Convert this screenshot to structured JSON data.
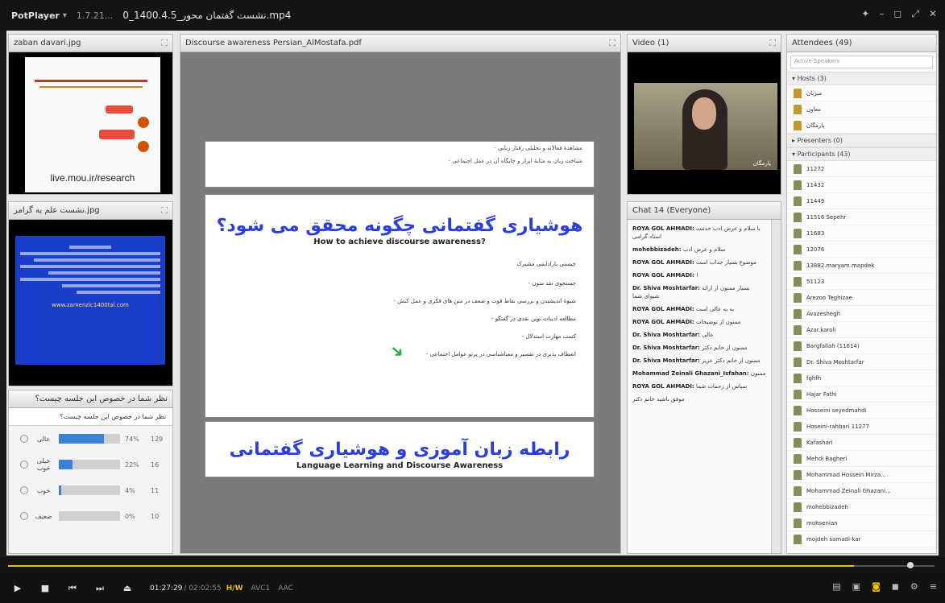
{
  "window": {
    "app_name": "PotPlayer",
    "version": "1.7.21...",
    "file_name": "0_1400.4.5_نشست گفتمان محور.mp4"
  },
  "left": {
    "image_pod_title": "zaban davari.jpg",
    "image_url_text": "live.mou.ir/research",
    "blue_pod_title": "نشست علم به گرامر.jpg",
    "blue_link_text": "www.zamenzic1400tal.com",
    "poll_title": "نظر شما در خصوص این جلسه چیست؟",
    "poll_question": "نظر شما در خصوص این جلسه چیست؟",
    "poll_options": [
      {
        "label": "عالی",
        "pct": "74%",
        "count": "129",
        "fraction": 0.74
      },
      {
        "label": "خیلی خوب",
        "pct": "22%",
        "count": "16",
        "fraction": 0.22
      },
      {
        "label": "خوب",
        "pct": "4%",
        "count": "11",
        "fraction": 0.04
      },
      {
        "label": "ضعیف",
        "pct": "0%",
        "count": "10",
        "fraction": 0.0
      }
    ]
  },
  "document": {
    "pod_title": "Discourse awareness Persian_AlMostafa.pdf",
    "slide1_line1": "- مشاهدهٔ فعالانه و تحلیلی رفتار زبانی",
    "slide1_line2": "- شناخت زبان به مثابهٔ ابزار و جایگاه آن در عمل اجتماعی",
    "slide2_title_fa": "هوشیاری گفتمانی چگونه محقق می شود؟",
    "slide2_title_en": "How to achieve discourse awareness?",
    "slide2_intro": "چیستی بارادایمی مشترک",
    "slide2_bullets": [
      "- جستجوی نقد متون",
      "- شیوهٔ اندیشیدن و بررسی نقاط قوت و ضعف در متن های فکری و عمل کنش",
      "- مطالعه ادبیات نوین نقدی در گفتگو",
      "- کسب مهارت استدلال",
      "- انعطاف پذیری در تفسیر و معناشناسی در پرتو عوامل اجتماعی"
    ],
    "slide3_title_fa": "رابطه زبان آموزی و هوشیاری گفتمانی",
    "slide3_title_en": "Language Learning and Discourse Awareness"
  },
  "video": {
    "pod_title": "Video (1)",
    "speaker_name": "پارمگان"
  },
  "chat": {
    "pod_title": "Chat 14 (Everyone)",
    "messages": [
      {
        "who": "ROYA GOL AHMADI:",
        "text": "با سلام و عرض ادب خدمت استاد گرامی"
      },
      {
        "who": "mohebbizadeh:",
        "text": "سلام و عرض ادب"
      },
      {
        "who": "ROYA GOL AHMADI:",
        "text": "موضوع بسیار جذاب است"
      },
      {
        "who": "ROYA GOL AHMADI:",
        "text": "!"
      },
      {
        "who": "Dr. Shiva Moshtarfar:",
        "text": "بسیار ممنون از ارائه شیوای شما"
      },
      {
        "who": "ROYA GOL AHMADI:",
        "text": "به به عالی است"
      },
      {
        "who": "ROYA GOL AHMADI:",
        "text": "ممنون از توضیحات"
      },
      {
        "who": "Dr. Shiva Moshtarfar:",
        "text": "عالی"
      },
      {
        "who": "Dr. Shiva Moshtarfar:",
        "text": "ممنون از خانم دکتر"
      },
      {
        "who": "Dr. Shiva Moshtarfar:",
        "text": "ممنون از خانم دکتر عزیز"
      },
      {
        "who": "Mohammad Zeinali Ghazani_Isfahan:",
        "text": "ممنون"
      },
      {
        "who": "ROYA GOL AHMADI:",
        "text": "سپاس از زحمات شما"
      },
      {
        "who": "",
        "text": "موفق باشید خانم دکتر"
      }
    ]
  },
  "attendees": {
    "pod_title": "Attendees (49)",
    "search_placeholder": "Active Speakers",
    "hosts_header": "Hosts (3)",
    "presenters_header": "Presenters (0)",
    "participants_header": "Participants (43)",
    "hosts": [
      "میزبان",
      "معاون",
      "پارمگان"
    ],
    "participants": [
      "11272",
      "11432",
      "11449",
      "11516 Sepehr",
      "11683",
      "12076",
      "13882.maryam.mapdek",
      "51123",
      "Arezoo Teghizae",
      "Avazeshegh",
      "Azar.karoli",
      "Bargfallah (11614)",
      "Dr. Shiva Moshtarfar",
      "fghfh",
      "Hajar Fathi",
      "Hosseini seyedmahdi",
      "Hoseini-rahbari 11277",
      "Kafashari",
      "Mehdi Bagheri",
      "Mohammad Hossein Mirza...",
      "Mohammad Zeinali Ghazani...",
      "mohebbizadeh",
      "mohsenian",
      "mojdeh samadi-kar"
    ]
  },
  "player": {
    "current_time": "01:27:29",
    "duration": "/ 02:02:55",
    "hw_label": "H/W",
    "video_codec": "AVC1",
    "audio_codec": "AAC",
    "seek_fraction": 0.955
  }
}
